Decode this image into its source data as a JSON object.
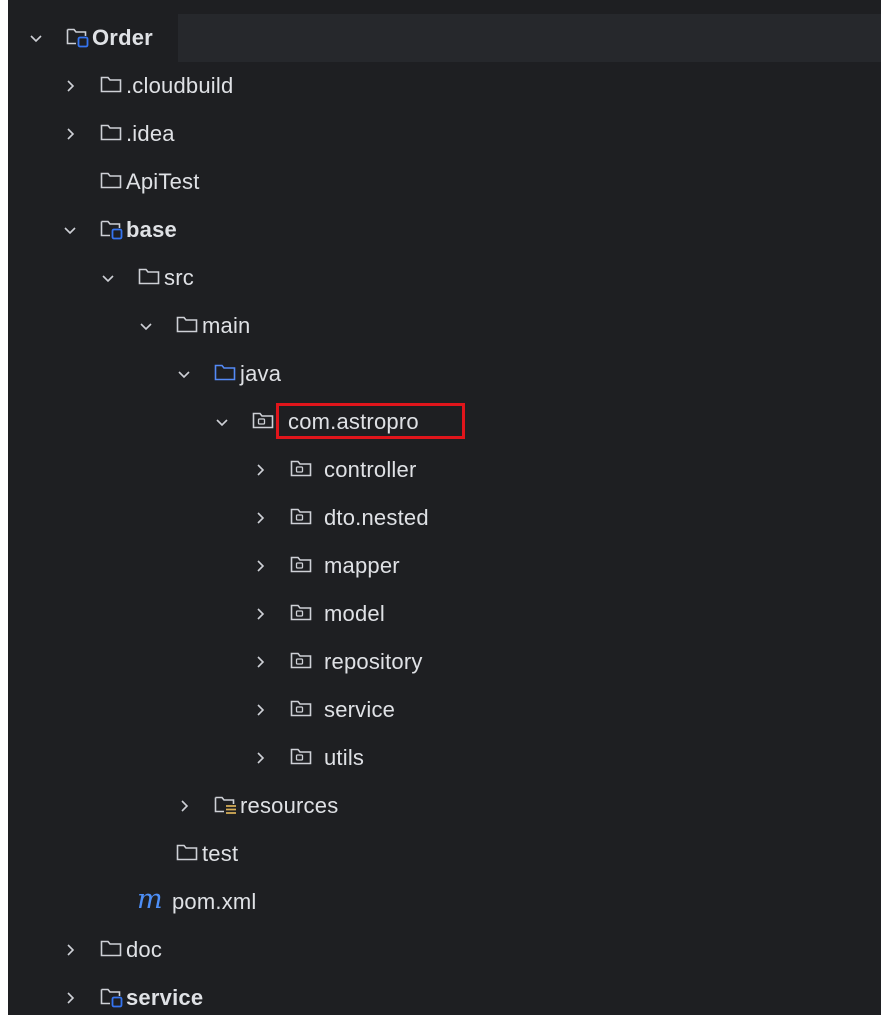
{
  "project_tree": {
    "rows": [
      {
        "label": "Order",
        "bold": true,
        "module": true,
        "expanded": true
      },
      {
        "label": ".cloudbuild",
        "expanded": false
      },
      {
        "label": ".idea",
        "expanded": false
      },
      {
        "label": "ApiTest"
      },
      {
        "label": "base",
        "bold": true,
        "module": true,
        "expanded": true
      },
      {
        "label": "src",
        "expanded": true
      },
      {
        "label": "main",
        "expanded": true
      },
      {
        "label": "java",
        "source_root": true,
        "expanded": true
      },
      {
        "label": "com.astropro",
        "package": true,
        "expanded": true,
        "highlighted": true
      },
      {
        "label": "controller",
        "package": true,
        "expanded": false
      },
      {
        "label": "dto.nested",
        "package": true,
        "expanded": false
      },
      {
        "label": "mapper",
        "package": true,
        "expanded": false
      },
      {
        "label": "model",
        "package": true,
        "expanded": false
      },
      {
        "label": "repository",
        "package": true,
        "expanded": false
      },
      {
        "label": "service",
        "package": true,
        "expanded": false
      },
      {
        "label": "utils",
        "package": true,
        "expanded": false
      },
      {
        "label": "resources",
        "resources_root": true,
        "expanded": false
      },
      {
        "label": "test"
      },
      {
        "label": "pom.xml",
        "maven": true
      },
      {
        "label": "doc",
        "expanded": false
      },
      {
        "label": "service",
        "bold": true,
        "module": true,
        "expanded": false
      }
    ]
  },
  "colors": {
    "background": "#1e1f22",
    "text": "#dfe1e5",
    "folder_icon": "#ced0d6",
    "module_accent": "#3574f0",
    "source_root": "#548af7",
    "resources_accent": "#d6ae58",
    "maven_m": "#4d8ff8",
    "highlight_box": "#e0151b"
  }
}
